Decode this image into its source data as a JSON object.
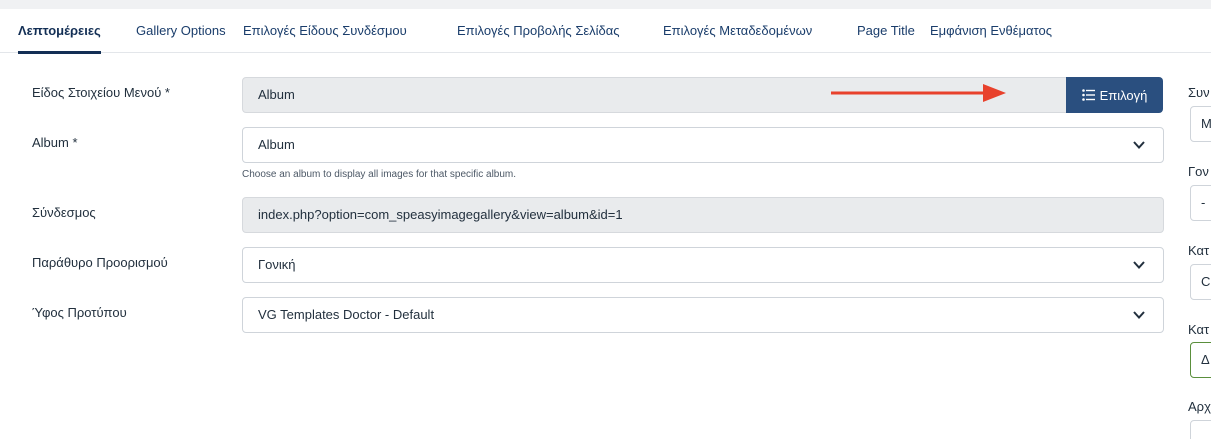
{
  "tabs": [
    {
      "label": "Λεπτομέρειες",
      "active": true
    },
    {
      "label": "Gallery Options",
      "active": false
    },
    {
      "label": "Επιλογές Είδους Συνδέσμου",
      "active": false
    },
    {
      "label": "Επιλογές Προβολής Σελίδας",
      "active": false
    },
    {
      "label": "Επιλογές Μεταδεδομένων",
      "active": false
    },
    {
      "label": "Page Title",
      "active": false
    },
    {
      "label": "Εμφάνιση Ενθέματος",
      "active": false
    }
  ],
  "form": {
    "menu_item_type": {
      "label": "Είδος Στοιχείου Μενού *",
      "value": "Album",
      "button_label": "Επιλογή"
    },
    "album": {
      "label": "Album *",
      "value": "Album",
      "help": "Choose an album to display all images for that specific album."
    },
    "link": {
      "label": "Σύνδεσμος",
      "value": "index.php?option=com_speasyimagegallery&view=album&id=1"
    },
    "target_window": {
      "label": "Παράθυρο Προορισμού",
      "value": "Γονική"
    },
    "template_style": {
      "label": "Ύφος Προτύπου",
      "value": "VG Templates Doctor - Default"
    }
  },
  "right_panel": {
    "labels": [
      "Συν",
      "Γον",
      "Κατ",
      "Κατ",
      "Αρχ"
    ],
    "boxes": [
      "M",
      "-",
      "C",
      "Δ",
      ""
    ]
  },
  "colors": {
    "primary_button": "#2a4f7f",
    "annotation_arrow": "#e8412c",
    "active_tab": "#132f55"
  }
}
